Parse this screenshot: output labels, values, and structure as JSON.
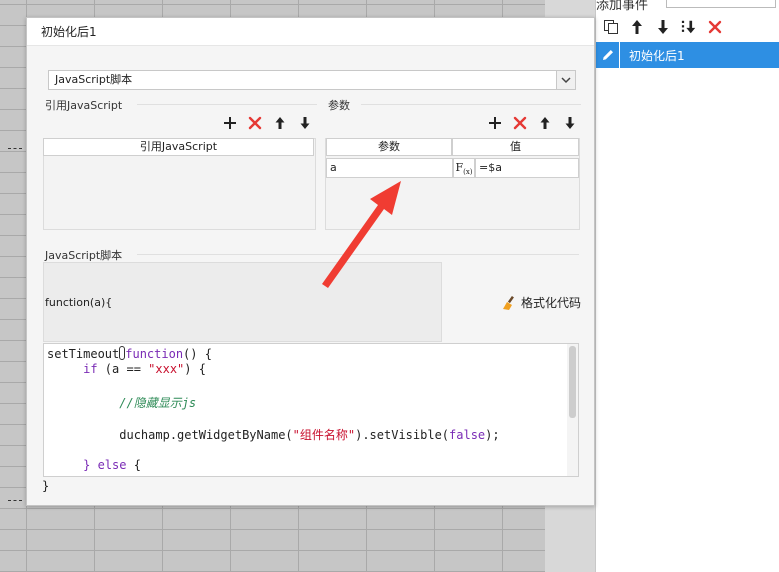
{
  "events_panel": {
    "title": "添加事件",
    "items": [
      {
        "label": "初始化后1"
      }
    ],
    "toolbar": [
      "copy-icon",
      "arrow-up-icon",
      "arrow-down-icon",
      "move-to-bottom-icon",
      "delete-icon"
    ]
  },
  "dialog": {
    "title": "初始化后1",
    "script_type": "JavaScript脚本",
    "ref_js": {
      "section_label": "引用JavaScript",
      "column_header": "引用JavaScript"
    },
    "params": {
      "section_label": "参数",
      "columns": [
        "参数",
        "值"
      ],
      "rows": [
        {
          "name": "a",
          "value": "=$a"
        }
      ]
    },
    "script_section_label": "JavaScript脚本",
    "function_signature": "function(a){",
    "format_button_label": "格式化代码",
    "closing_brace": "}",
    "code_lines": [
      {
        "parts": [
          {
            "t": "setTimeout",
            "c": ""
          },
          {
            "t": "",
            "c": "cursor"
          },
          {
            "t": "function",
            "c": "kw"
          },
          {
            "t": "() {",
            "c": ""
          }
        ]
      },
      {
        "parts": [
          {
            "t": "     ",
            "c": ""
          },
          {
            "t": "if",
            "c": "kw"
          },
          {
            "t": " (a == ",
            "c": ""
          },
          {
            "t": "\"xxx\"",
            "c": "str"
          },
          {
            "t": ") {",
            "c": ""
          }
        ]
      },
      {
        "parts": []
      },
      {
        "parts": [
          {
            "t": "          ",
            "c": ""
          },
          {
            "t": "//隐藏显示js",
            "c": "cm"
          }
        ]
      },
      {
        "parts": []
      },
      {
        "parts": [
          {
            "t": "          duchamp.getWidgetByName(",
            "c": ""
          },
          {
            "t": "\"组件名称\"",
            "c": "str"
          },
          {
            "t": ").setVisible(",
            "c": ""
          },
          {
            "t": "false",
            "c": "kw"
          },
          {
            "t": ");",
            "c": ""
          }
        ]
      },
      {
        "parts": []
      },
      {
        "parts": [
          {
            "t": "     ",
            "c": ""
          },
          {
            "t": "} else",
            "c": "kw"
          },
          {
            "t": " {",
            "c": ""
          }
        ]
      }
    ]
  },
  "colors": {
    "accent": "#2e8fe3",
    "delete": "#e53935",
    "arrow_annotation": "#f03c32"
  }
}
